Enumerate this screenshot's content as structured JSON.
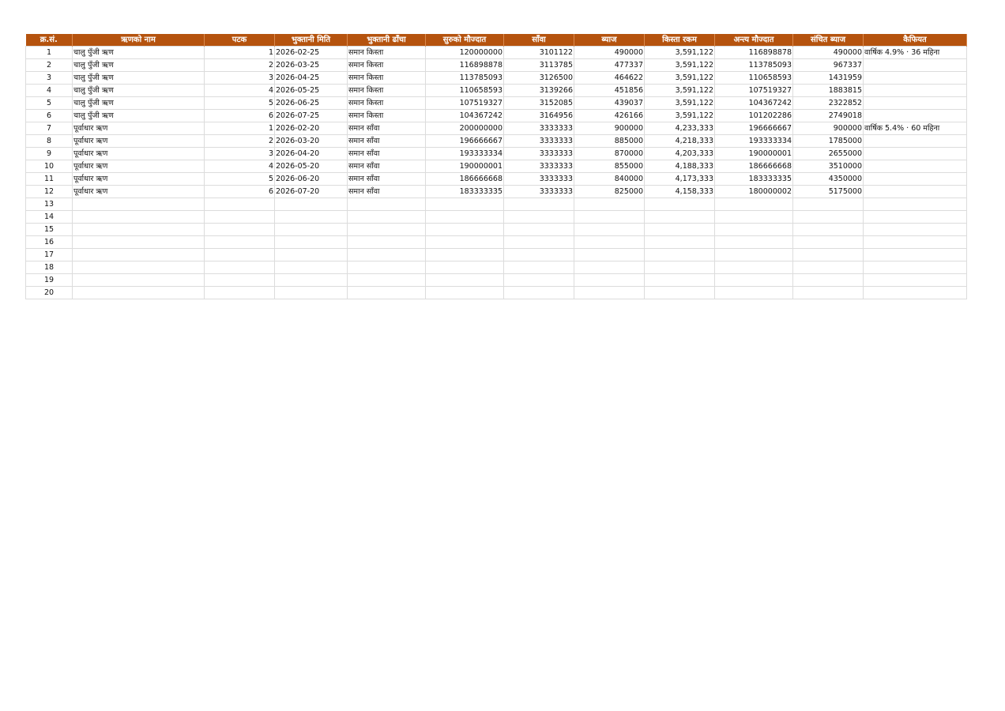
{
  "columns": [
    "क्र.सं.",
    "ऋणको नाम",
    "पटक",
    "भुक्तानी मिति",
    "भुक्तानी ढाँचा",
    "सुरुको मौज्दात",
    "साँवा",
    "ब्याज",
    "किस्ता रकम",
    "अन्त्य मौज्दात",
    "संचित ब्याज",
    "कैफियत"
  ],
  "rows": [
    [
      "1",
      "चालु पुँजी ऋण",
      "1",
      "2026-02-25",
      "समान किस्ता",
      "120000000",
      "3101122",
      "490000",
      "3,591,122",
      "116898878",
      "490000",
      "वार्षिक 4.9% · 36 महिना"
    ],
    [
      "2",
      "चालु पुँजी ऋण",
      "2",
      "2026-03-25",
      "समान किस्ता",
      "116898878",
      "3113785",
      "477337",
      "3,591,122",
      "113785093",
      "967337",
      ""
    ],
    [
      "3",
      "चालु पुँजी ऋण",
      "3",
      "2026-04-25",
      "समान किस्ता",
      "113785093",
      "3126500",
      "464622",
      "3,591,122",
      "110658593",
      "1431959",
      ""
    ],
    [
      "4",
      "चालु पुँजी ऋण",
      "4",
      "2026-05-25",
      "समान किस्ता",
      "110658593",
      "3139266",
      "451856",
      "3,591,122",
      "107519327",
      "1883815",
      ""
    ],
    [
      "5",
      "चालु पुँजी ऋण",
      "5",
      "2026-06-25",
      "समान किस्ता",
      "107519327",
      "3152085",
      "439037",
      "3,591,122",
      "104367242",
      "2322852",
      ""
    ],
    [
      "6",
      "चालु पुँजी ऋण",
      "6",
      "2026-07-25",
      "समान किस्ता",
      "104367242",
      "3164956",
      "426166",
      "3,591,122",
      "101202286",
      "2749018",
      ""
    ],
    [
      "7",
      "पूर्वाधार ऋण",
      "1",
      "2026-02-20",
      "समान साँवा",
      "200000000",
      "3333333",
      "900000",
      "4,233,333",
      "196666667",
      "900000",
      "वार्षिक 5.4% · 60 महिना"
    ],
    [
      "8",
      "पूर्वाधार ऋण",
      "2",
      "2026-03-20",
      "समान साँवा",
      "196666667",
      "3333333",
      "885000",
      "4,218,333",
      "193333334",
      "1785000",
      ""
    ],
    [
      "9",
      "पूर्वाधार ऋण",
      "3",
      "2026-04-20",
      "समान साँवा",
      "193333334",
      "3333333",
      "870000",
      "4,203,333",
      "190000001",
      "2655000",
      ""
    ],
    [
      "10",
      "पूर्वाधार ऋण",
      "4",
      "2026-05-20",
      "समान साँवा",
      "190000001",
      "3333333",
      "855000",
      "4,188,333",
      "186666668",
      "3510000",
      ""
    ],
    [
      "11",
      "पूर्वाधार ऋण",
      "5",
      "2026-06-20",
      "समान साँवा",
      "186666668",
      "3333333",
      "840000",
      "4,173,333",
      "183333335",
      "4350000",
      ""
    ],
    [
      "12",
      "पूर्वाधार ऋण",
      "6",
      "2026-07-20",
      "समान साँवा",
      "183333335",
      "3333333",
      "825000",
      "4,158,333",
      "180000002",
      "5175000",
      ""
    ],
    [
      "13",
      "",
      "",
      "",
      "",
      "",
      "",
      "",
      "",
      "",
      "",
      ""
    ],
    [
      "14",
      "",
      "",
      "",
      "",
      "",
      "",
      "",
      "",
      "",
      "",
      ""
    ],
    [
      "15",
      "",
      "",
      "",
      "",
      "",
      "",
      "",
      "",
      "",
      "",
      ""
    ],
    [
      "16",
      "",
      "",
      "",
      "",
      "",
      "",
      "",
      "",
      "",
      "",
      ""
    ],
    [
      "17",
      "",
      "",
      "",
      "",
      "",
      "",
      "",
      "",
      "",
      "",
      ""
    ],
    [
      "18",
      "",
      "",
      "",
      "",
      "",
      "",
      "",
      "",
      "",
      "",
      ""
    ],
    [
      "19",
      "",
      "",
      "",
      "",
      "",
      "",
      "",
      "",
      "",
      "",
      ""
    ],
    [
      "20",
      "",
      "",
      "",
      "",
      "",
      "",
      "",
      "",
      "",
      "",
      ""
    ]
  ],
  "colors": {
    "header_bg": "#b5530e",
    "header_text": "#ffffff",
    "grid": "#dcdcdc"
  }
}
